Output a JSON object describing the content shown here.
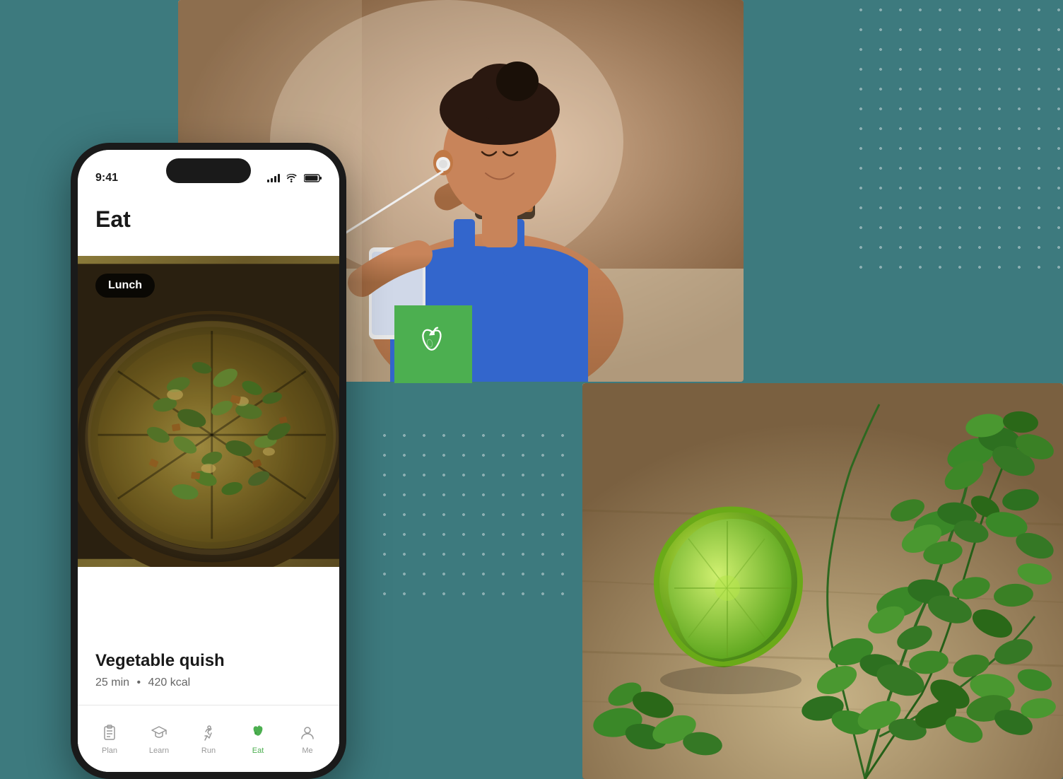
{
  "background": {
    "color": "#3d7a7e"
  },
  "phone": {
    "status_time": "9:41",
    "header_title": "Eat",
    "lunch_badge": "Lunch",
    "food_name": "Vegetable quish",
    "food_time": "25 min",
    "food_calories": "420 kcal",
    "separator": "•",
    "nav_items": [
      {
        "label": "Plan",
        "icon": "clipboard-icon",
        "active": false
      },
      {
        "label": "Learn",
        "icon": "graduation-icon",
        "active": false
      },
      {
        "label": "Run",
        "icon": "run-icon",
        "active": false
      },
      {
        "label": "Eat",
        "icon": "apple-icon",
        "active": true
      },
      {
        "label": "Me",
        "icon": "person-icon",
        "active": false
      }
    ]
  },
  "icons": {
    "apple": "🍎",
    "apple_outline": "apple-outline"
  },
  "accent_color": "#4CAF50",
  "dot_color": "rgba(255,255,255,0.4)"
}
